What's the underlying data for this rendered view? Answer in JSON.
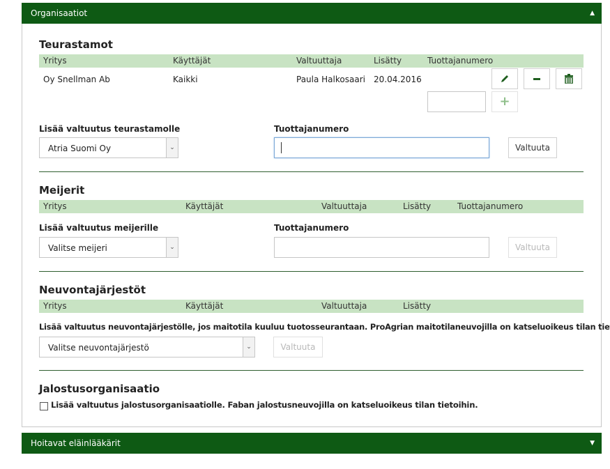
{
  "header_top": {
    "title": "Organisaatiot",
    "caret": "▲"
  },
  "teurastamot": {
    "title": "Teurastamot",
    "columns": [
      "Yritys",
      "Käyttäjät",
      "Valtuuttaja",
      "Lisätty",
      "Tuottajanumero"
    ],
    "row": {
      "yritys": "Oy Snellman Ab",
      "kayttajat": "Kaikki",
      "valtuuttaja": "Paula Halkosaari",
      "lisatty": "20.04.2016",
      "tuottajanumero": ""
    },
    "add_label": "Lisää valtuutus teurastamolle",
    "select_value": "Atria Suomi Oy",
    "number_label": "Tuottajanumero",
    "button": "Valtuuta"
  },
  "meijerit": {
    "title": "Meijerit",
    "columns": [
      "Yritys",
      "Käyttäjät",
      "Valtuuttaja",
      "Lisätty",
      "Tuottajanumero"
    ],
    "add_label": "Lisää valtuutus meijerille",
    "select_value": "Valitse meijeri",
    "number_label": "Tuottajanumero",
    "button": "Valtuuta"
  },
  "neuvonta": {
    "title": "Neuvontajärjestöt",
    "columns": [
      "Yritys",
      "Käyttäjät",
      "Valtuuttaja",
      "Lisätty"
    ],
    "add_label": "Lisää valtuutus neuvontajärjestölle, jos maitotila kuuluu tuotosseurantaan. ProAgrian maitotilaneuvojilla on katseluoikeus tilan tietoihin.",
    "select_value": "Valitse neuvontajärjestö",
    "button": "Valtuuta"
  },
  "jalostus": {
    "title": "Jalostusorganisaatio",
    "checkbox_label": "Lisää valtuutus jalostusorganisaatiolle. Faban jalostusneuvojilla on katseluoikeus tilan tietoihin."
  },
  "header_bottom": {
    "title": "Hoitavat eläinlääkärit",
    "caret": "▼"
  }
}
